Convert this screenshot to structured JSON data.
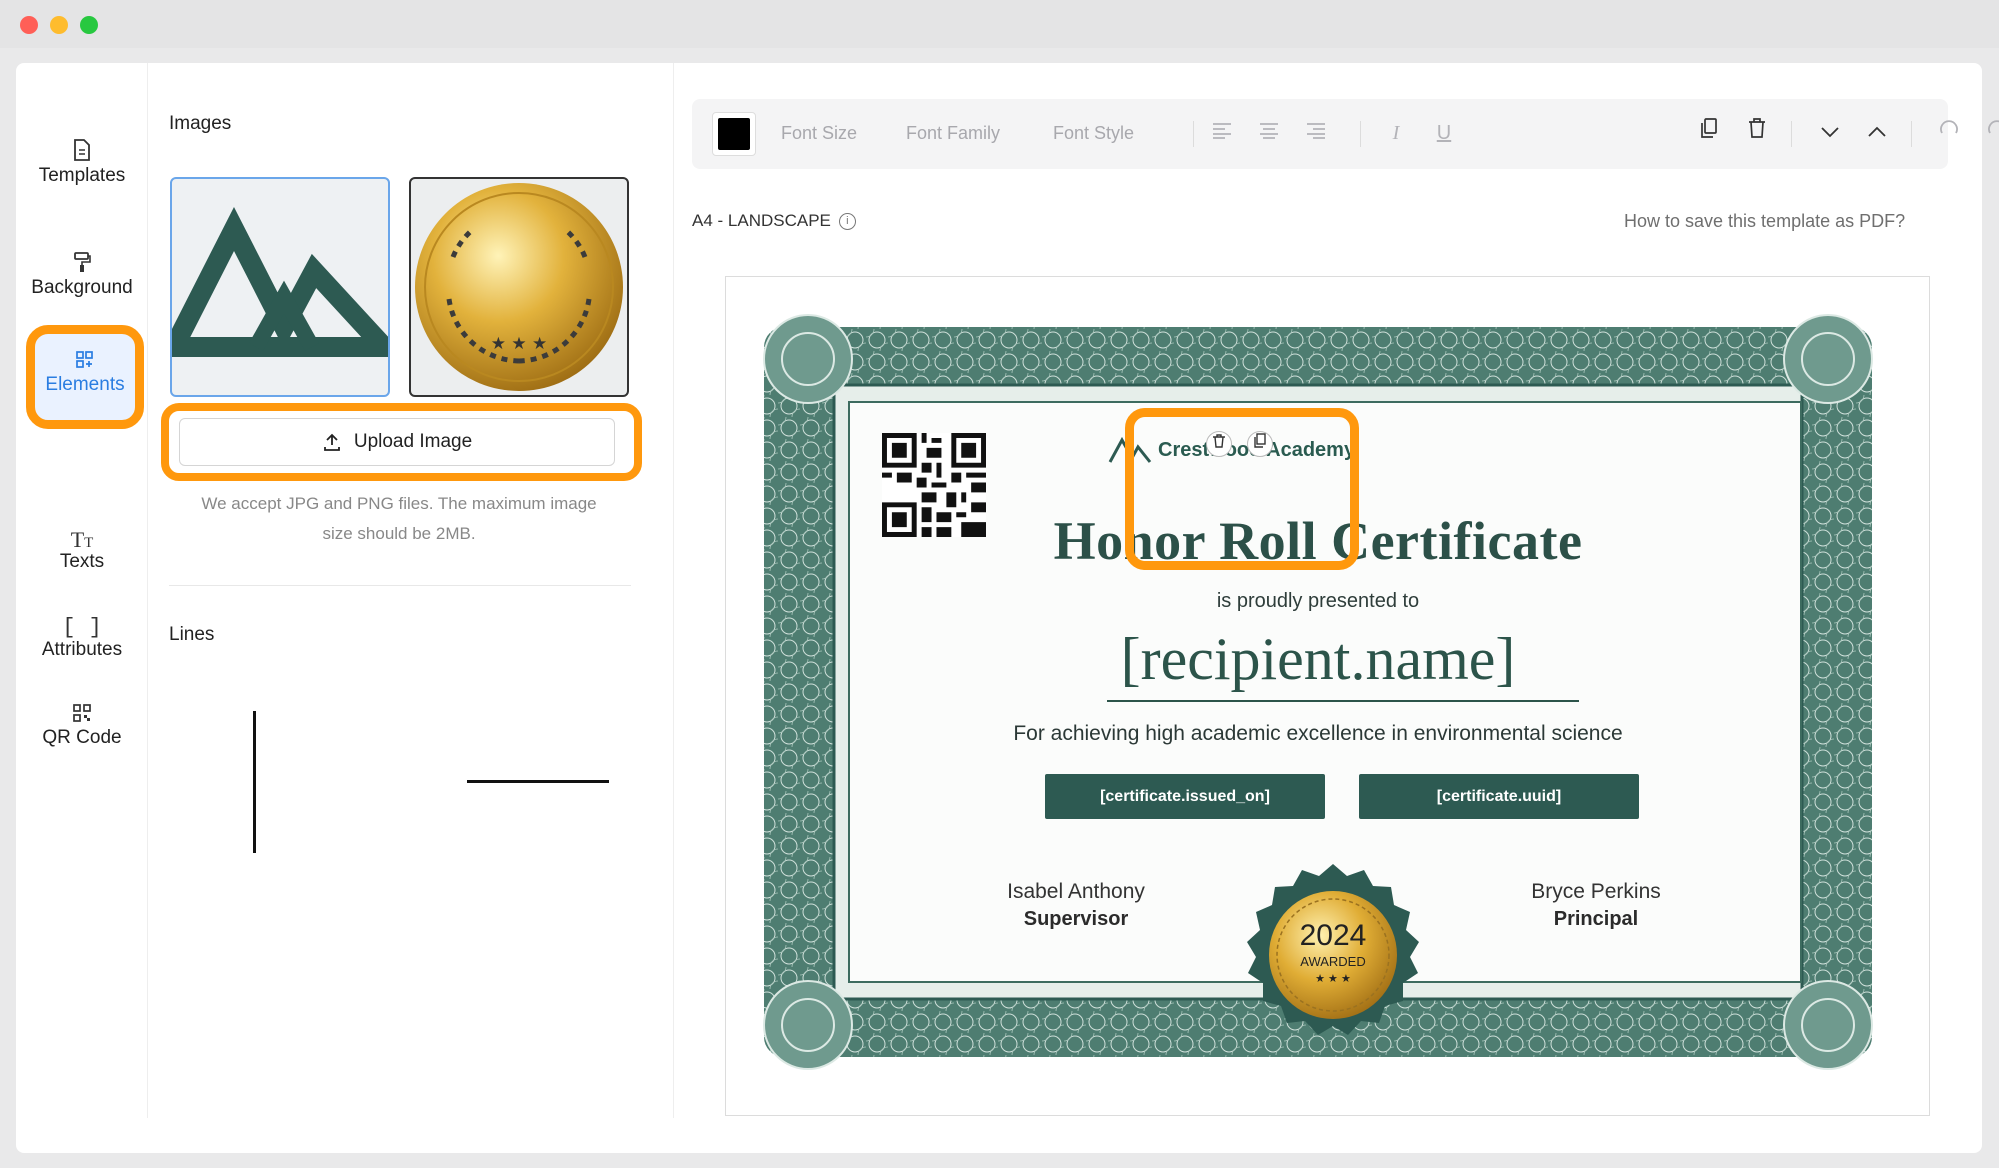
{
  "sidebar": {
    "items": [
      {
        "label": "Templates"
      },
      {
        "label": "Background"
      },
      {
        "label": "Elements"
      },
      {
        "label": "Texts"
      },
      {
        "label": "Attributes"
      },
      {
        "label": "QR Code"
      }
    ],
    "active": "Elements"
  },
  "panel": {
    "images_title": "Images",
    "upload_label": "Upload Image",
    "upload_hint": "We accept JPG and PNG files. The maximum image size should be 2MB.",
    "lines_title": "Lines"
  },
  "toolbar": {
    "color": "#000000",
    "font_size": "Font Size",
    "font_family": "Font Family",
    "font_style": "Font Style"
  },
  "canvas": {
    "page_size": "A4 - LANDSCAPE",
    "help_link": "How to save this template as PDF?"
  },
  "certificate": {
    "academy": "Crestwood Academy",
    "title": "Honor Roll Certificate",
    "presented": "is proudly presented to",
    "recipient": "[recipient.name]",
    "reason": "For achieving high academic excellence in environmental science",
    "issued_on": "[certificate.issued_on]",
    "uuid": "[certificate.uuid]",
    "signer_left_name": "Isabel Anthony",
    "signer_left_role": "Supervisor",
    "signer_right_name": "Bryce Perkins",
    "signer_right_role": "Principal",
    "seal_year": "2024",
    "seal_text": "AWARDED"
  },
  "colors": {
    "highlight": "#ff980d",
    "accent": "#2a7de1",
    "certificate_green": "#2d5a52"
  }
}
